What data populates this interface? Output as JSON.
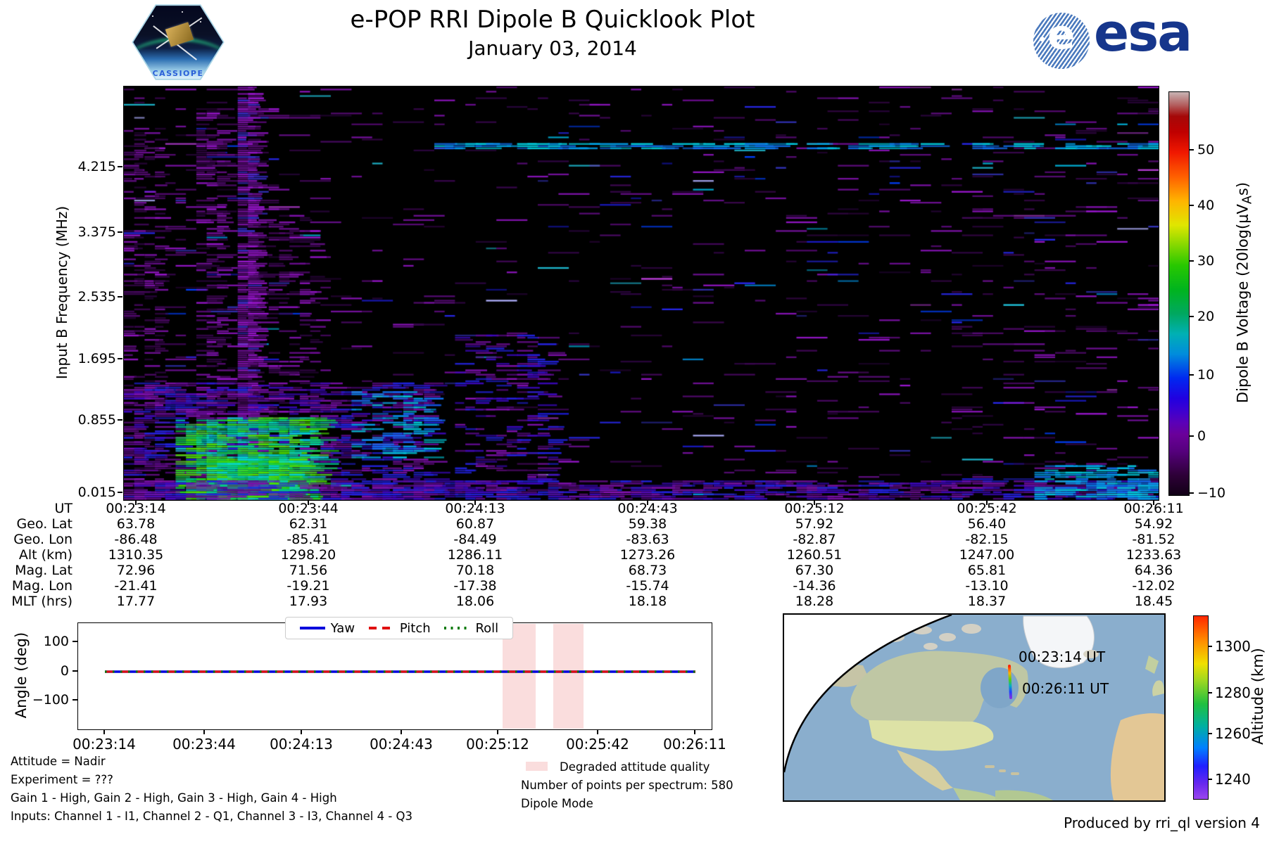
{
  "header": {
    "title": "e-POP RRI Dipole B Quicklook Plot",
    "date": "January 03, 2014",
    "cassiope_logo_text": "CASSIOPE",
    "esa_logo_text": "esa"
  },
  "spectrogram": {
    "ylabel": "Input B Frequency (MHz)",
    "yticks": [
      "4.215",
      "3.375",
      "2.535",
      "1.695",
      "0.855",
      "0.015"
    ],
    "colorbar": {
      "label_prefix": "Dipole B Voltage (20log(μV",
      "label_sub": "A",
      "label_suffix": "s)",
      "ticks": [
        "50",
        "40",
        "30",
        "20",
        "10",
        "0",
        "−10"
      ]
    }
  },
  "ephemeris": {
    "row_labels": [
      "UT",
      "Geo. Lat",
      "Geo. Lon",
      "Alt (km)",
      "Mag. Lat",
      "Mag. Lon",
      "MLT (hrs)"
    ],
    "columns": [
      [
        "00:23:14",
        "63.78",
        "-86.48",
        "1310.35",
        "72.96",
        "-21.41",
        "17.77"
      ],
      [
        "00:23:44",
        "62.31",
        "-85.41",
        "1298.20",
        "71.56",
        "-19.21",
        "17.93"
      ],
      [
        "00:24:13",
        "60.87",
        "-84.49",
        "1286.11",
        "70.18",
        "-17.38",
        "18.06"
      ],
      [
        "00:24:43",
        "59.38",
        "-83.63",
        "1273.26",
        "68.73",
        "-15.74",
        "18.18"
      ],
      [
        "00:25:12",
        "57.92",
        "-82.87",
        "1260.51",
        "67.30",
        "-14.36",
        "18.28"
      ],
      [
        "00:25:42",
        "56.40",
        "-82.15",
        "1247.00",
        "65.81",
        "-13.10",
        "18.37"
      ],
      [
        "00:26:11",
        "54.92",
        "-81.52",
        "1233.63",
        "64.36",
        "-12.02",
        "18.45"
      ]
    ]
  },
  "attitude": {
    "ylabel": "Angle (deg)",
    "yticks": [
      "100",
      "0",
      "−100"
    ],
    "xticks": [
      "00:23:14",
      "00:23:44",
      "00:24:13",
      "00:24:43",
      "00:25:12",
      "00:25:42",
      "00:26:11"
    ],
    "legend": [
      {
        "label": "Yaw",
        "color": "#0000dd",
        "style": "solid"
      },
      {
        "label": "Pitch",
        "color": "#e01010",
        "style": "dashed"
      },
      {
        "label": "Roll",
        "color": "#0a7a0a",
        "style": "dotted"
      }
    ]
  },
  "annotations": {
    "attitude_line": "Attitude = Nadir",
    "experiment_line": "Experiment = ???",
    "gain_line": "Gain 1 - High, Gain 2 - High, Gain 3 - High, Gain 4 - High",
    "inputs_line": "Inputs: Channel 1 - I1, Channel 2 - Q1, Channel 3 - I3, Channel 4 - Q3",
    "degraded_label": "Degraded attitude quality",
    "points_line": "Number of points per spectrum: 580",
    "mode_line": "Dipole Mode"
  },
  "map": {
    "start_label": "00:23:14 UT",
    "end_label": "00:26:11 UT",
    "colorbar": {
      "label": "Altitude (km)",
      "ticks": [
        "1300",
        "1280",
        "1260",
        "1240"
      ]
    }
  },
  "footer": {
    "credit": "Produced by rri_ql version 4"
  },
  "chart_data": [
    {
      "type": "heatmap",
      "name": "rri-dipole-b-spectrogram",
      "title": "e-POP RRI Dipole B Quicklook Plot — January 03, 2014",
      "xlabel": "UT",
      "ylabel": "Input B Frequency (MHz)",
      "x_ticks": [
        "00:23:14",
        "00:23:44",
        "00:24:13",
        "00:24:43",
        "00:25:12",
        "00:25:42",
        "00:26:11"
      ],
      "y_ticks_mhz": [
        4.215,
        3.375,
        2.535,
        1.695,
        0.855,
        0.015
      ],
      "colorbar": {
        "label": "Dipole B Voltage (20log(μV_As)",
        "ticks": [
          50,
          40,
          30,
          20,
          10,
          0,
          -10
        ],
        "range": [
          -10,
          58
        ]
      },
      "description": "Mostly noise-floor (black) spectrogram with sparse thin horizontal purple interference streaks; dense vertical interference band near 00:23:35-00:23:40 spanning all frequencies; strong broadband enhancement (blue/cyan/green, ~15-35 units) below ~1 MHz from 00:23:14 to ~00:24:00; persistent weak enhancement along lowest frequencies across the whole pass; faint blue horizontal line near 4.2 MHz over the right half; streak density slightly higher at far right.",
      "render": {
        "seed": 20140103,
        "bg": "#000000",
        "cols": 100,
        "rows": 190,
        "base_density": 0.045,
        "palettes": {
          "purple": [
            "#3a0650",
            "#52096e",
            "#6b0d90",
            "#8412b2",
            "#9a16cf",
            "#2c0540"
          ],
          "blue": [
            "#1c1cd8",
            "#2828ee",
            "#0040ff",
            "#3333bb"
          ],
          "cyan": [
            "#0096e6",
            "#00b4dc",
            "#20c8e0"
          ],
          "bright": [
            "#c040e0",
            "#b0b0ff"
          ],
          "band": [
            "#6b0d90",
            "#8412b2",
            "#3a30d0",
            "#52096e",
            "#9a16cf"
          ],
          "green_cyan": [
            "#10c040",
            "#2ad81e",
            "#00c890",
            "#00d8d0",
            "#50e000"
          ],
          "blue_purple": [
            "#2222dd",
            "#5c0a8a",
            "#7c10aa",
            "#3c08c0"
          ],
          "cyan_blue": [
            "#00a0e8",
            "#1070f0",
            "#00c8d8"
          ]
        },
        "blobs": [
          {
            "x0": 0.0,
            "x1": 0.04,
            "y0": 0.1,
            "y1": 1.0,
            "density": 0.3,
            "palette": "purple",
            "maxlen": 0.8
          },
          {
            "x0": 0.078,
            "x1": 0.097,
            "y0": 0.05,
            "y1": 1.0,
            "density": 0.38,
            "palette": "purple",
            "maxlen": 1.2
          },
          {
            "x0": 0.11,
            "x1": 0.128,
            "y0": 0.0,
            "y1": 1.0,
            "density": 0.85,
            "palette": "band",
            "maxlen": 1.2
          },
          {
            "x0": 0.128,
            "x1": 0.19,
            "y0": 0.3,
            "y1": 1.0,
            "density": 0.2,
            "palette": "purple",
            "maxlen": 1.2
          },
          {
            "x0": 0.0,
            "x1": 0.3,
            "y0": 0.72,
            "y1": 1.0,
            "density": 0.42,
            "palette": "blue_purple",
            "maxlen": 2.0
          },
          {
            "x0": 0.05,
            "x1": 0.19,
            "y0": 0.8,
            "y1": 1.0,
            "density": 0.75,
            "palette": "green_cyan",
            "maxlen": 2.0
          },
          {
            "x0": 0.08,
            "x1": 0.17,
            "y0": 0.9,
            "y1": 1.0,
            "density": 0.95,
            "palette": "green_cyan",
            "maxlen": 2.0
          },
          {
            "x0": 0.22,
            "x1": 0.3,
            "y0": 0.74,
            "y1": 0.9,
            "density": 0.35,
            "palette": "cyan_blue",
            "maxlen": 1.5
          },
          {
            "x0": 0.32,
            "x1": 0.42,
            "y0": 0.6,
            "y1": 1.0,
            "density": 0.22,
            "palette": "blue_purple",
            "maxlen": 1.5
          },
          {
            "x0": 0.0,
            "x1": 1.0,
            "y0": 0.955,
            "y1": 1.0,
            "density": 0.5,
            "palette": "blue_purple",
            "maxlen": 2.5
          },
          {
            "x0": 0.88,
            "x1": 1.0,
            "y0": 0.92,
            "y1": 1.0,
            "density": 0.55,
            "palette": "cyan_blue",
            "maxlen": 2.0
          },
          {
            "x0": 0.3,
            "x1": 1.0,
            "y0": 0.138,
            "y1": 0.15,
            "density": 0.5,
            "palette": "cyan_blue",
            "maxlen": 3.0
          }
        ]
      }
    },
    {
      "type": "line",
      "name": "attitude-angles",
      "ylabel": "Angle (deg)",
      "ylim": [
        -190,
        170
      ],
      "yticks": [
        100,
        0,
        -100
      ],
      "x_ticks": [
        "00:23:14",
        "00:23:44",
        "00:24:13",
        "00:24:43",
        "00:25:12",
        "00:25:42",
        "00:26:11"
      ],
      "series": [
        {
          "name": "Yaw",
          "color": "#0000dd",
          "style": "solid",
          "value_deg": 0
        },
        {
          "name": "Pitch",
          "color": "#e01010",
          "style": "dashed",
          "value_deg": 0
        },
        {
          "name": "Roll",
          "color": "#0a7a0a",
          "style": "dotted",
          "value_deg": 0
        }
      ],
      "note": "Yaw, Pitch and Roll all flat at ~0 deg over the whole interval",
      "degraded_color": "#fadddd",
      "degraded_bands_frac": [
        {
          "x0": 0.67,
          "x1": 0.722
        },
        {
          "x0": 0.75,
          "x1": 0.798
        }
      ]
    },
    {
      "type": "map",
      "name": "ground-track-map",
      "track": {
        "start": {
          "label": "00:23:14 UT",
          "geo_lat": 63.78,
          "geo_lon": -86.48,
          "alt_km": 1310.35
        },
        "end": {
          "label": "00:26:11 UT",
          "geo_lat": 54.92,
          "geo_lon": -81.52,
          "alt_km": 1233.63
        }
      },
      "colorbar": {
        "label": "Altitude (km)",
        "ticks": [
          1300,
          1280,
          1260,
          1240
        ],
        "range": [
          1232,
          1313
        ]
      }
    }
  ]
}
